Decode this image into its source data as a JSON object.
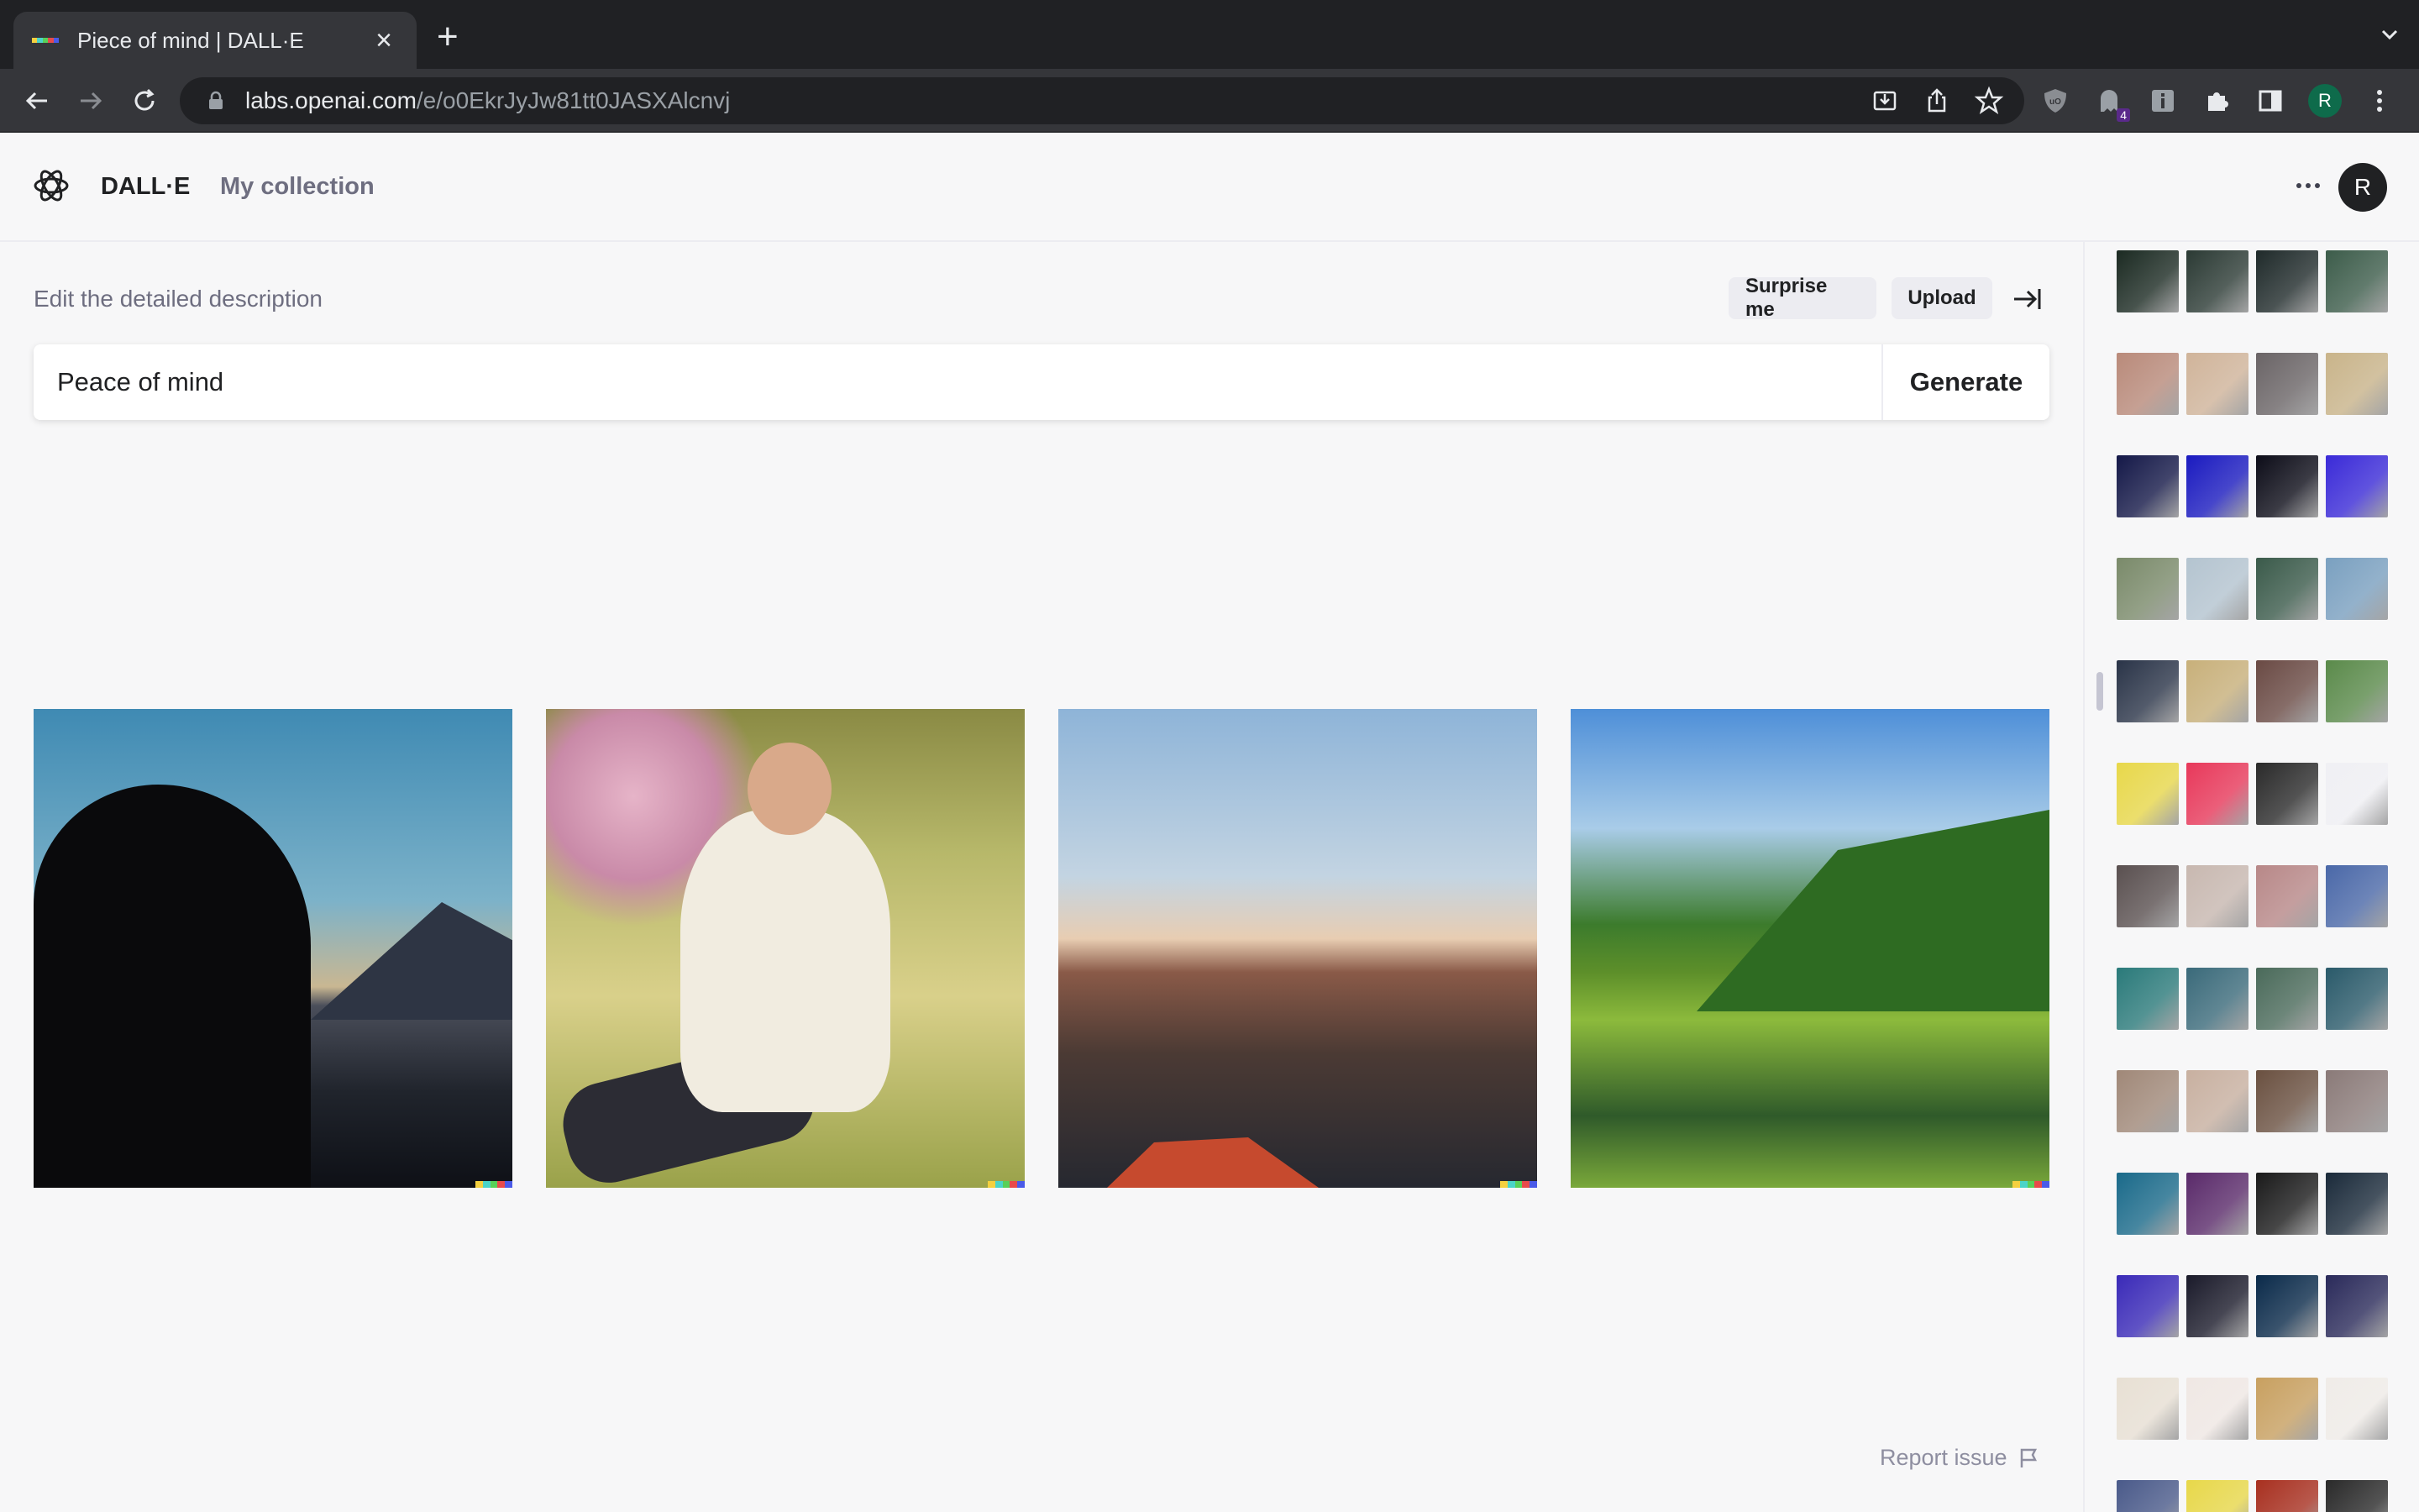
{
  "browser": {
    "tab_title": "Piece of mind | DALL·E",
    "url_host": "labs.openai.com",
    "url_path": "/e/o0EkrJyJw81tt0JASXAlcnvj",
    "extension_badge": "4",
    "profile_initial": "R"
  },
  "header": {
    "brand": "DALL·E",
    "nav_collection": "My collection",
    "avatar_initial": "R"
  },
  "editor": {
    "label": "Edit the detailed description",
    "surprise_label": "Surprise me",
    "upload_label": "Upload",
    "prompt_value": "Peace of mind",
    "generate_label": "Generate"
  },
  "results": [
    {
      "name": "result-image-silhouette-lake"
    },
    {
      "name": "result-image-yoga-woman"
    },
    {
      "name": "result-image-mountain-valley"
    },
    {
      "name": "result-image-green-lake"
    }
  ],
  "footer": {
    "report_label": "Report issue"
  },
  "colors": {
    "accent": "#202123",
    "muted": "#6e6e80",
    "pill_bg": "#ececf1"
  },
  "history_rows": [
    [
      "#1b2a22",
      "#2b3a34",
      "#1f2a2a",
      "#3c5c4a"
    ],
    [
      "#b98a7a",
      "#d0b49a",
      "#6a6466",
      "#c9b48a"
    ],
    [
      "#141848",
      "#1a1ac0",
      "#0c0c18",
      "#3a2ad8"
    ],
    [
      "#7a8a6a",
      "#b4c4d0",
      "#3a5a4a",
      "#7aa0c0"
    ],
    [
      "#2a3448",
      "#c8b07a",
      "#6a4a44",
      "#5a8a4a"
    ],
    [
      "#e8d84a",
      "#e8385a",
      "#2a2a2a",
      "#f0f0f4"
    ],
    [
      "#5a5050",
      "#c8b8b0",
      "#b88888",
      "#4a68a8"
    ],
    [
      "#2a7a7a",
      "#3a6a7a",
      "#4a6a5a",
      "#2a5a6a"
    ],
    [
      "#a08878",
      "#c8b0a0",
      "#6a5040",
      "#8a7a78"
    ],
    [
      "#1a6a8a",
      "#5a2a6a",
      "#1a1a1a",
      "#1a2a3a"
    ],
    [
      "#3a2ab8",
      "#1a1a2a",
      "#0a2a4a",
      "#2a2a5a"
    ],
    [
      "#e8e0d4",
      "#f0e8e4",
      "#c8a060",
      "#f0ece8"
    ],
    [
      "#4a5a8a",
      "#e8d84a",
      "#a83020",
      "#2a2a2a"
    ]
  ]
}
